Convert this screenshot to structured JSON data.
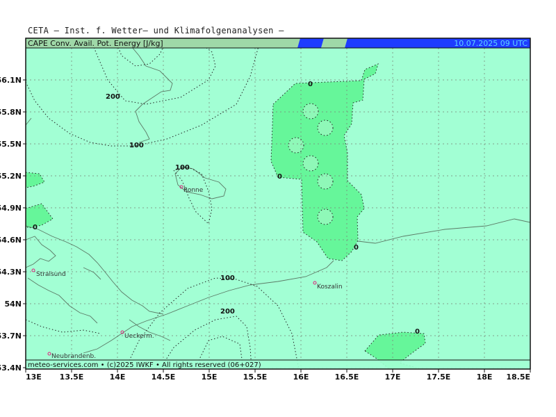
{
  "header": {
    "institute": "CETA — Inst. f. Wetter— und Klimafolgenanalysen —",
    "parameter": "CAPE Conv. Avail. Pot. Energy [J/kg]",
    "valid_time": "10.07.2025 09 UTC"
  },
  "footer": {
    "credit": "meteo-services.com • (c)2025 IWKF • All rights reserved (06+027)"
  },
  "axes": {
    "lon_ticks": [
      "13E",
      "13.5E",
      "14E",
      "14.5E",
      "15E",
      "15.5E",
      "16E",
      "16.5E",
      "17E",
      "17.5E",
      "18E",
      "18.5E"
    ],
    "lat_ticks": [
      "56.1N",
      "55.8N",
      "55.5N",
      "55.2N",
      "54.9N",
      "54.6N",
      "54.3N",
      "54N",
      "53.7N",
      "53.4N"
    ]
  },
  "cities": [
    {
      "name": "Ronne"
    },
    {
      "name": "Stralsund"
    },
    {
      "name": "Koszalin"
    },
    {
      "name": "Ueckerm."
    },
    {
      "name": "Neubrandenb."
    }
  ],
  "contour_labels": [
    "200",
    "100",
    "100",
    "0",
    "0",
    "0",
    "0",
    "100",
    "200",
    "0"
  ],
  "colors": {
    "sea_fill": "#a2ffd4",
    "cape_low": "#66f69a",
    "cape_mid": "#8ff8b8",
    "title_bar_left": "#9fd8a8",
    "title_bar_blue": "#1e3cff",
    "city_marker": "#e0207a"
  }
}
